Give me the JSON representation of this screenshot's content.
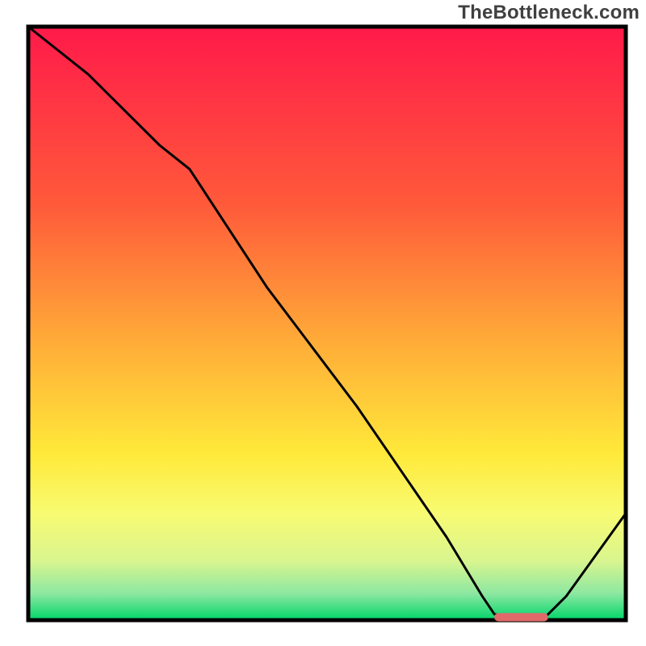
{
  "attribution": "TheBottleneck.com",
  "chart_data": {
    "type": "line",
    "title": "",
    "xlabel": "",
    "ylabel": "",
    "xlim": [
      0,
      100
    ],
    "ylim": [
      0,
      100
    ],
    "grid": false,
    "axes_visible": false,
    "background_gradient": {
      "stops": [
        {
          "pos": 0.0,
          "color": "#ff1a4a"
        },
        {
          "pos": 0.3,
          "color": "#ff5a3a"
        },
        {
          "pos": 0.52,
          "color": "#ffa838"
        },
        {
          "pos": 0.72,
          "color": "#ffe93a"
        },
        {
          "pos": 0.82,
          "color": "#f8fb72"
        },
        {
          "pos": 0.9,
          "color": "#d9f58f"
        },
        {
          "pos": 0.955,
          "color": "#8de8a1"
        },
        {
          "pos": 1.0,
          "color": "#00d56a"
        }
      ]
    },
    "series": [
      {
        "name": "bottleneck-curve",
        "color": "#000000",
        "x": [
          0,
          10,
          22,
          27,
          40,
          55,
          70,
          76,
          78,
          83,
          86,
          90,
          100
        ],
        "y": [
          100,
          92,
          80,
          76,
          56,
          36,
          14,
          4,
          1,
          0,
          0,
          4,
          18
        ]
      }
    ],
    "marker": {
      "name": "target-range",
      "color": "#e06a6a",
      "x_start": 78,
      "x_end": 87,
      "y": 0.5,
      "thickness_pct": 1.4
    }
  }
}
